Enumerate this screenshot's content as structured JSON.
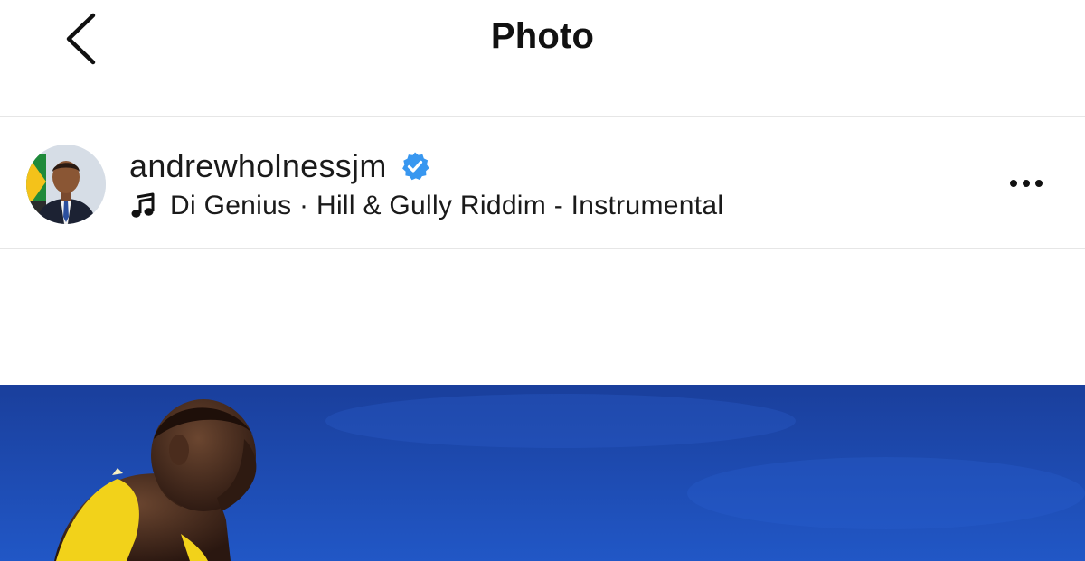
{
  "navbar": {
    "title": "Photo",
    "back_icon": "chevron-left-icon"
  },
  "post": {
    "username": "andrewholnessjm",
    "verified": true,
    "verified_icon": "verified-badge-icon",
    "verified_color": "#3897f0",
    "audio": {
      "icon": "music-note-icon",
      "text": "Di Genius · Hill & Gully Riddim - Instrumental"
    },
    "more_icon": "more-horizontal-icon"
  },
  "photo": {
    "sky_color": "#1e4fb4",
    "jersey_color": "#f2d21a"
  }
}
